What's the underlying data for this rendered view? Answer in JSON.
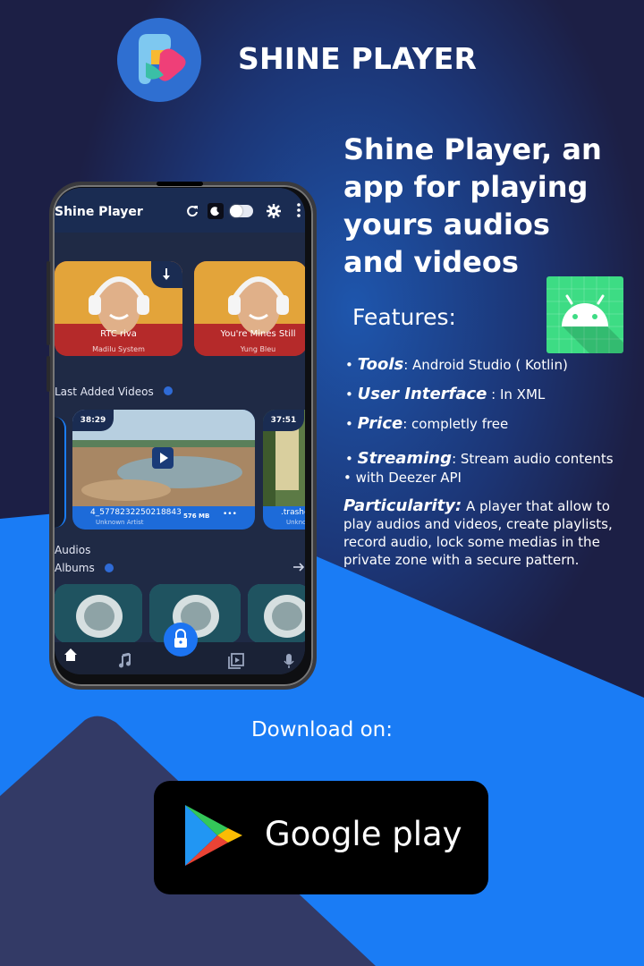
{
  "header": {
    "title": "SHINE PLAYER",
    "logo": "shine-player-logo"
  },
  "headline": {
    "line1": "Shine Player, an",
    "line2": "app for playing",
    "line3": "yours audios",
    "line4": "and videos"
  },
  "features": {
    "title": "Features:",
    "badge_icon": "android-icon",
    "items": [
      {
        "bullet": "•",
        "label": "Tools",
        "text": ": Android Studio ( Kotlin)"
      },
      {
        "bullet": "•",
        "label": "User Interface",
        "text": " : In XML"
      },
      {
        "bullet": "•",
        "label": "Price",
        "text": ": completly free"
      },
      {
        "bullet": "•",
        "label": "Streaming",
        "text": ": Stream audio contents"
      }
    ],
    "streaming_sub": "•   with Deezer API",
    "particularity_label": "Particularity:",
    "particularity_text": " A player that allow to play audios and videos, create playlists, record audio, lock some medias in the private zone with a secure pattern."
  },
  "download": {
    "label": "Download on:",
    "store_name": "Google play",
    "store_icon": "google-play-icon"
  },
  "phone": {
    "app_title": "Shine Player",
    "songs": [
      {
        "title": "RTC riva",
        "artist": "Madilu System"
      },
      {
        "title": "You're Mines Still",
        "artist": "Yung Bleu"
      }
    ],
    "last_added_label": "Last Added Videos",
    "videos": [
      {
        "duration": "38:29",
        "name": "4_5778232250218843",
        "artist": "Unknown Artist",
        "size": "576 MB"
      },
      {
        "duration": "37:51",
        "name": ".trashe",
        "artist": "Unknow"
      }
    ],
    "audios_label": "Audios",
    "albums_label": "Albums"
  },
  "colors": {
    "background_dark": "#1c1f45",
    "accent_blue": "#1a7cf5",
    "android_green": "#3ddc84"
  }
}
